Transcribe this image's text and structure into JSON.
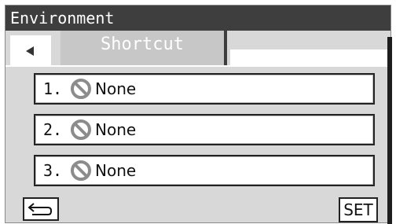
{
  "window": {
    "title": "Environment"
  },
  "tabs": [
    {
      "label": "Shortcut",
      "active": true
    }
  ],
  "back_button": {
    "icon": "left-arrow-icon"
  },
  "shortcuts": [
    {
      "number": "1.",
      "icon": "prohibited-icon",
      "label": "None"
    },
    {
      "number": "2.",
      "icon": "prohibited-icon",
      "label": "None"
    },
    {
      "number": "3.",
      "icon": "prohibited-icon",
      "label": "None"
    }
  ],
  "footer": {
    "return_icon": "return-arrow-icon",
    "set_label": "SET"
  },
  "colors": {
    "header": "#3e3e3e",
    "panel": "#d8d8d8",
    "tab": "#c7c7c7",
    "prohibited": "#8c8c8c"
  }
}
